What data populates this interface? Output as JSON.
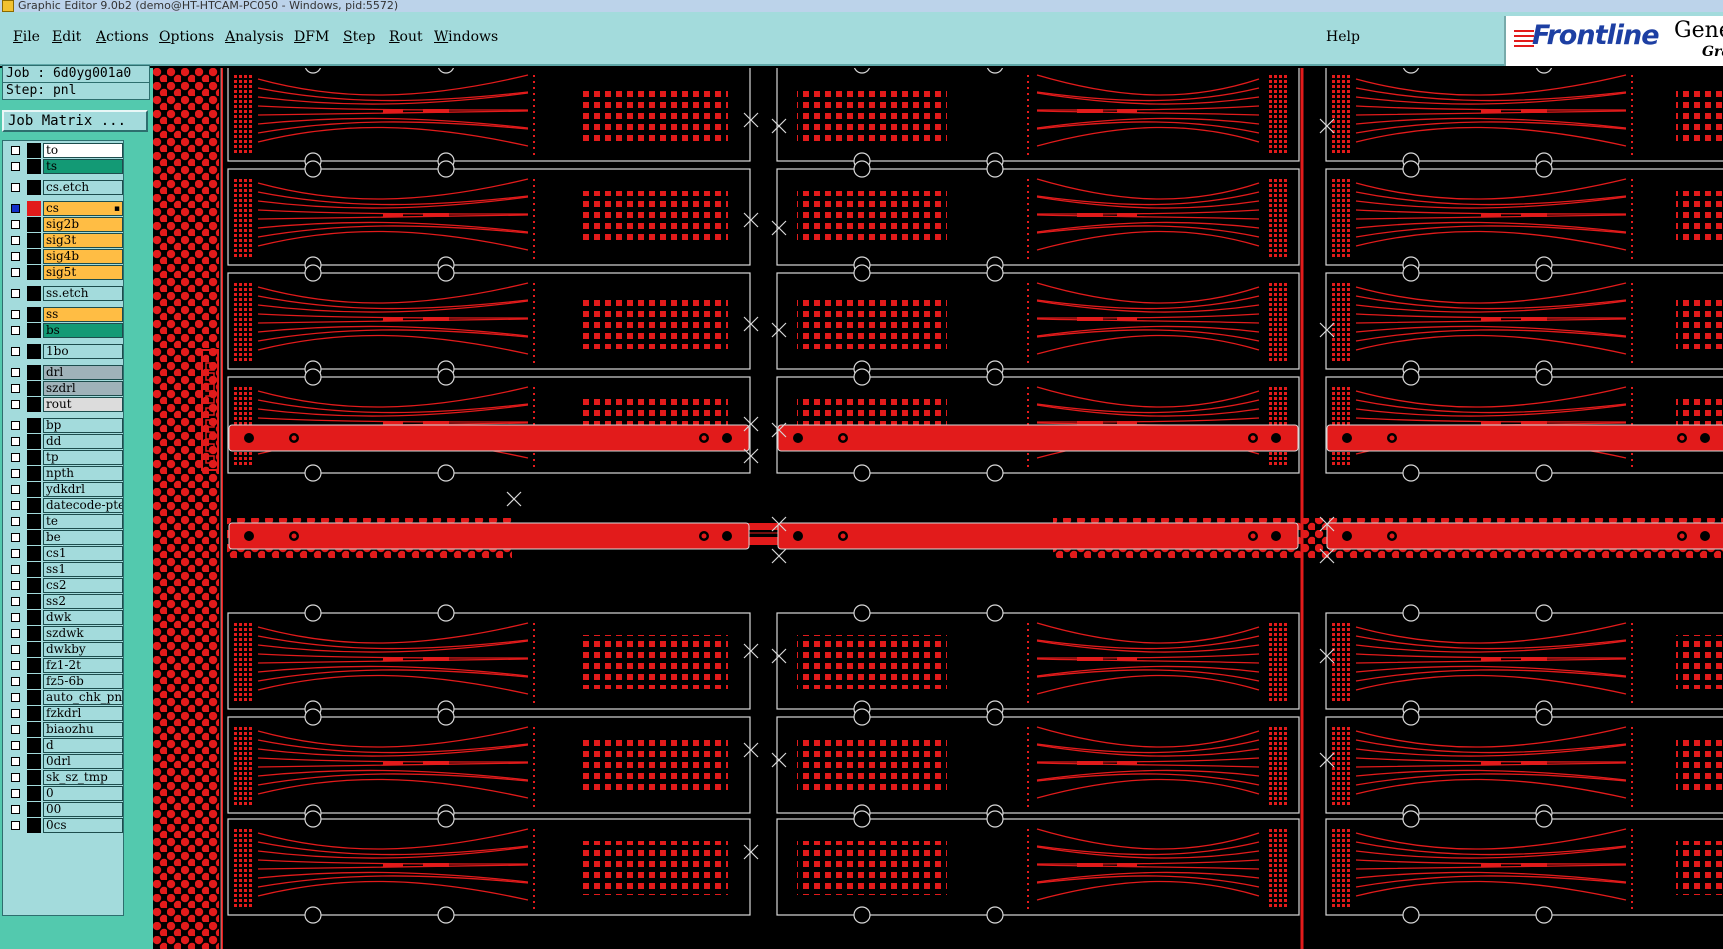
{
  "window": {
    "title": "Graphic Editor 9.0b2 (demo@HT-HTCAM-PC050 - Windows, pid:5572)"
  },
  "menu": {
    "items": [
      {
        "label": "File",
        "underline": "F"
      },
      {
        "label": "Edit",
        "underline": "E"
      },
      {
        "label": "Actions",
        "underline": "A"
      },
      {
        "label": "Options",
        "underline": "O"
      },
      {
        "label": "Analysis",
        "underline": "A"
      },
      {
        "label": "DFM",
        "underline": "D"
      },
      {
        "label": "Step",
        "underline": "S"
      },
      {
        "label": "Rout",
        "underline": "R"
      },
      {
        "label": "Windows",
        "underline": "W"
      }
    ],
    "help": "Help"
  },
  "brand": {
    "logo_text": "Frontline",
    "side_text_top": "Gene",
    "side_text_bottom": "Grap"
  },
  "job_info": {
    "job": "Job : 6d0yg001a0",
    "step": "Step: pnl",
    "job_matrix_label": "Job Matrix ..."
  },
  "layers": [
    {
      "name": "to",
      "style": "white",
      "group": 0
    },
    {
      "name": "ts",
      "style": "green",
      "group": 0
    },
    {
      "name": "cs.etch",
      "style": "plain",
      "group": 1
    },
    {
      "name": "cs",
      "style": "orange",
      "group": 2,
      "selected": true,
      "mark": "▪"
    },
    {
      "name": "sig2b",
      "style": "orange",
      "group": 2
    },
    {
      "name": "sig3t",
      "style": "orange",
      "group": 2
    },
    {
      "name": "sig4b",
      "style": "orange",
      "group": 2
    },
    {
      "name": "sig5t",
      "style": "orange",
      "group": 2
    },
    {
      "name": "ss.etch",
      "style": "plain",
      "group": 3
    },
    {
      "name": "ss",
      "style": "orange",
      "group": 4
    },
    {
      "name": "bs",
      "style": "green",
      "group": 4
    },
    {
      "name": "1bo",
      "style": "plain",
      "group": 5
    },
    {
      "name": "drl",
      "style": "grey",
      "group": 6
    },
    {
      "name": "szdrl",
      "style": "grey",
      "group": 6
    },
    {
      "name": "rout",
      "style": "light",
      "group": 6
    },
    {
      "name": "bp",
      "style": "plain",
      "group": 7
    },
    {
      "name": "dd",
      "style": "plain",
      "group": 7
    },
    {
      "name": "tp",
      "style": "plain",
      "group": 7
    },
    {
      "name": "npth",
      "style": "plain",
      "group": 7
    },
    {
      "name": "ydkdrl",
      "style": "plain",
      "group": 7
    },
    {
      "name": "datecode-pte",
      "style": "plain",
      "group": 7
    },
    {
      "name": "te",
      "style": "plain",
      "group": 7
    },
    {
      "name": "be",
      "style": "plain",
      "group": 7
    },
    {
      "name": "cs1",
      "style": "plain",
      "group": 7
    },
    {
      "name": "ss1",
      "style": "plain",
      "group": 7
    },
    {
      "name": "cs2",
      "style": "plain",
      "group": 7
    },
    {
      "name": "ss2",
      "style": "plain",
      "group": 7
    },
    {
      "name": "dwk",
      "style": "plain",
      "group": 7
    },
    {
      "name": "szdwk",
      "style": "plain",
      "group": 7
    },
    {
      "name": "dwkby",
      "style": "plain",
      "group": 7
    },
    {
      "name": "fz1-2t",
      "style": "plain",
      "group": 7
    },
    {
      "name": "fz5-6b",
      "style": "plain",
      "group": 7
    },
    {
      "name": "auto_chk_pnl",
      "style": "plain",
      "group": 7
    },
    {
      "name": "fzkdrl",
      "style": "plain",
      "group": 7
    },
    {
      "name": "biaozhu",
      "style": "plain",
      "group": 7
    },
    {
      "name": "d",
      "style": "plain",
      "group": 7
    },
    {
      "name": "0drl",
      "style": "plain",
      "group": 7
    },
    {
      "name": "sk_sz_tmp",
      "style": "plain",
      "group": 7
    },
    {
      "name": "0",
      "style": "plain",
      "group": 7
    },
    {
      "name": "00",
      "style": "plain",
      "group": 7
    },
    {
      "name": "0cs",
      "style": "plain",
      "group": 7
    }
  ],
  "colors": {
    "menubar": "#a3dbdc",
    "panel": "#53c9ae",
    "canvas": "#000000",
    "feature_red": "#e21b1b",
    "outline": "#d8d8d8",
    "brand_blue": "#1d3fa3"
  }
}
